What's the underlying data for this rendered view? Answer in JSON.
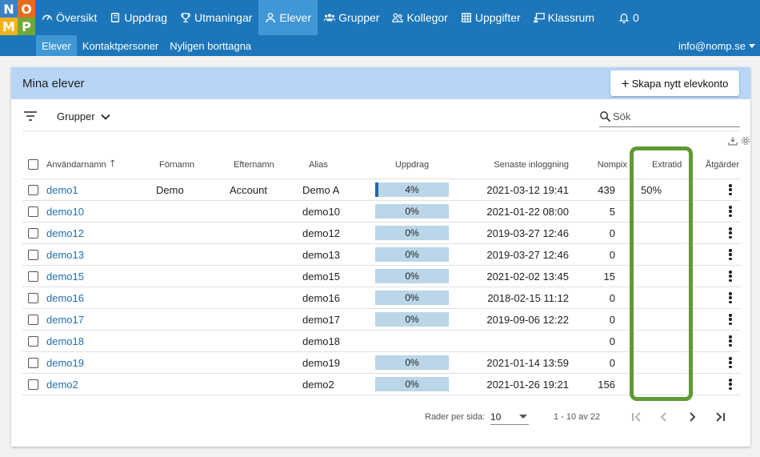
{
  "logo": {
    "letters": [
      "N",
      "O",
      "M",
      "P"
    ],
    "colors": [
      "#3b82c4",
      "#e56c1f",
      "#f2b21a",
      "#6fa938"
    ]
  },
  "nav": {
    "items": [
      {
        "label": "Översikt",
        "icon": "dashboard-icon"
      },
      {
        "label": "Uppdrag",
        "icon": "book-icon"
      },
      {
        "label": "Utmaningar",
        "icon": "trophy-icon"
      },
      {
        "label": "Elever",
        "icon": "user-icon",
        "active": true
      },
      {
        "label": "Grupper",
        "icon": "users-icon"
      },
      {
        "label": "Kollegor",
        "icon": "colleagues-icon"
      },
      {
        "label": "Uppgifter",
        "icon": "table-icon"
      },
      {
        "label": "Klassrum",
        "icon": "classroom-icon"
      },
      {
        "label": "0",
        "icon": "bell-icon"
      }
    ]
  },
  "subnav": {
    "items": [
      "Elever",
      "Kontaktpersoner",
      "Nyligen borttagna"
    ],
    "user": "info@nomp.se"
  },
  "card": {
    "title": "Mina elever",
    "create_button": "Skapa nytt elevkonto",
    "groups_label": "Grupper",
    "search_placeholder": "Sök"
  },
  "table": {
    "columns": {
      "username": "Användarnamn",
      "first_name": "Förnamn",
      "last_name": "Efternamn",
      "alias": "Alias",
      "progress": "Uppdrag",
      "last_login": "Senaste inloggning",
      "nompix": "Nompix",
      "extra_time": "Extratid",
      "actions": "Åtgärder"
    },
    "rows": [
      {
        "username": "demo1",
        "first_name": "Demo",
        "last_name": "Account",
        "alias": "Demo A",
        "progress": "4%",
        "progress_value": 0.04,
        "last_login": "2021-03-12 19:41",
        "nompix": "439",
        "extra_time": "50%"
      },
      {
        "username": "demo10",
        "first_name": "",
        "last_name": "",
        "alias": "demo10",
        "progress": "0%",
        "progress_value": 0,
        "last_login": "2021-01-22 08:00",
        "nompix": "5",
        "extra_time": ""
      },
      {
        "username": "demo12",
        "first_name": "",
        "last_name": "",
        "alias": "demo12",
        "progress": "0%",
        "progress_value": 0,
        "last_login": "2019-03-27 12:46",
        "nompix": "0",
        "extra_time": ""
      },
      {
        "username": "demo13",
        "first_name": "",
        "last_name": "",
        "alias": "demo13",
        "progress": "0%",
        "progress_value": 0,
        "last_login": "2019-03-27 12:46",
        "nompix": "0",
        "extra_time": ""
      },
      {
        "username": "demo15",
        "first_name": "",
        "last_name": "",
        "alias": "demo15",
        "progress": "0%",
        "progress_value": 0,
        "last_login": "2021-02-02 13:45",
        "nompix": "15",
        "extra_time": ""
      },
      {
        "username": "demo16",
        "first_name": "",
        "last_name": "",
        "alias": "demo16",
        "progress": "0%",
        "progress_value": 0,
        "last_login": "2018-02-15 11:12",
        "nompix": "0",
        "extra_time": ""
      },
      {
        "username": "demo17",
        "first_name": "",
        "last_name": "",
        "alias": "demo17",
        "progress": "0%",
        "progress_value": 0,
        "last_login": "2019-09-06 12:22",
        "nompix": "0",
        "extra_time": ""
      },
      {
        "username": "demo18",
        "first_name": "",
        "last_name": "",
        "alias": "demo18",
        "progress": "",
        "progress_value": null,
        "last_login": "",
        "nompix": "0",
        "extra_time": ""
      },
      {
        "username": "demo19",
        "first_name": "",
        "last_name": "",
        "alias": "demo19",
        "progress": "0%",
        "progress_value": 0,
        "last_login": "2021-01-14 13:59",
        "nompix": "0",
        "extra_time": ""
      },
      {
        "username": "demo2",
        "first_name": "",
        "last_name": "",
        "alias": "demo2",
        "progress": "0%",
        "progress_value": 0,
        "last_login": "2021-01-26 19:21",
        "nompix": "156",
        "extra_time": ""
      }
    ]
  },
  "pagination": {
    "rows_per_page_label": "Rader per sida:",
    "rows_per_page": "10",
    "range": "1 - 10 av 22"
  },
  "colors": {
    "nav_bg": "#1c76b9",
    "nav_active": "#3f97d6",
    "header_bg": "#b7d6f7",
    "link": "#1f6fb0",
    "progress_bg": "#bad6e8",
    "progress_fill": "#2266aa",
    "highlight": "#5f9a34"
  }
}
